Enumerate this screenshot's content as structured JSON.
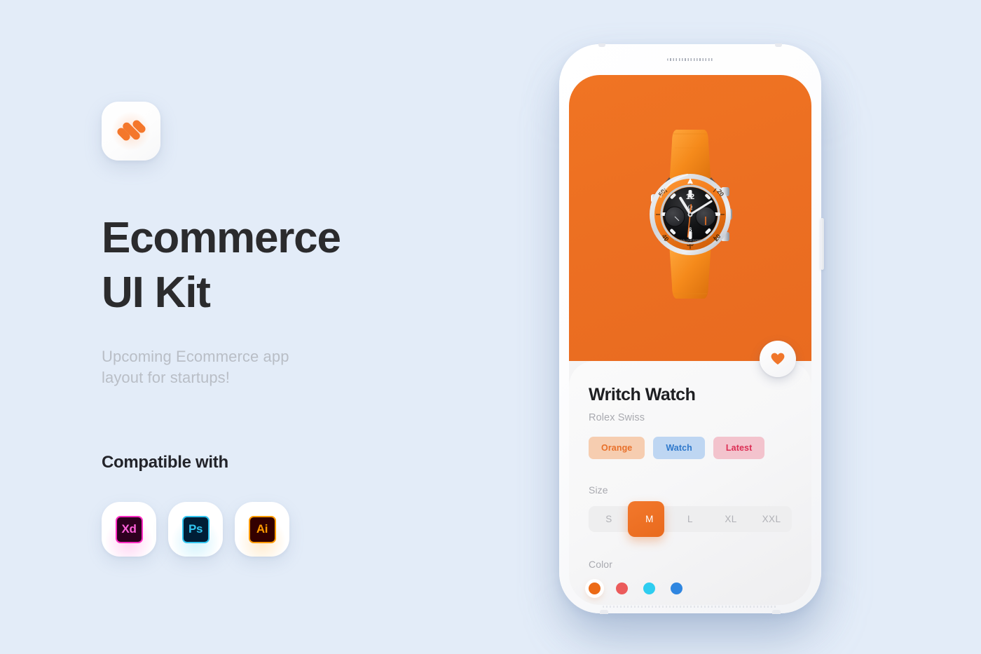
{
  "page": {
    "background_color": "#e3ecf8"
  },
  "left_panel": {
    "logo": {
      "icon": "three-diagonal-bars-logo",
      "color": "#F4772B"
    },
    "headline_line1": "Ecommerce",
    "headline_line2": "UI Kit",
    "subtitle_line1": "Upcoming Ecommerce app",
    "subtitle_line2": "layout for startups!",
    "compatible_title": "Compatible with",
    "apps": [
      {
        "label": "Xd",
        "name": "adobe-xd",
        "accent": "#FF2BC2"
      },
      {
        "label": "Ps",
        "name": "adobe-photoshop",
        "accent": "#31C5F0"
      },
      {
        "label": "Ai",
        "name": "adobe-illustrator",
        "accent": "#FF9A00"
      }
    ]
  },
  "phone": {
    "hero": {
      "background_color": "#EC6F22",
      "product_image": "orange-chronograph-wristwatch"
    },
    "favorite_button": {
      "icon": "heart-icon",
      "color": "#F0762B",
      "active": true
    },
    "product": {
      "title": "Writch Watch",
      "brand": "Rolex Swiss",
      "tags": [
        {
          "label": "Orange",
          "bg": "#F6CDB0",
          "fg": "#E8702A"
        },
        {
          "label": "Watch",
          "bg": "#BED6F2",
          "fg": "#2E78CB"
        },
        {
          "label": "Latest",
          "bg": "#F3C3CD",
          "fg": "#DC2E54"
        }
      ],
      "size": {
        "label": "Size",
        "options": [
          "S",
          "M",
          "L",
          "XL",
          "XXL"
        ],
        "selected": "M",
        "selected_index": 1,
        "accent": "#EE7328"
      },
      "color": {
        "label": "Color",
        "swatches": [
          {
            "name": "orange",
            "hex": "#EC6A16",
            "selected": true
          },
          {
            "name": "red",
            "hex": "#EB5B5B",
            "selected": false
          },
          {
            "name": "cyan",
            "hex": "#2ECDF0",
            "selected": false
          },
          {
            "name": "blue",
            "hex": "#2F86E0",
            "selected": false
          }
        ]
      }
    }
  }
}
